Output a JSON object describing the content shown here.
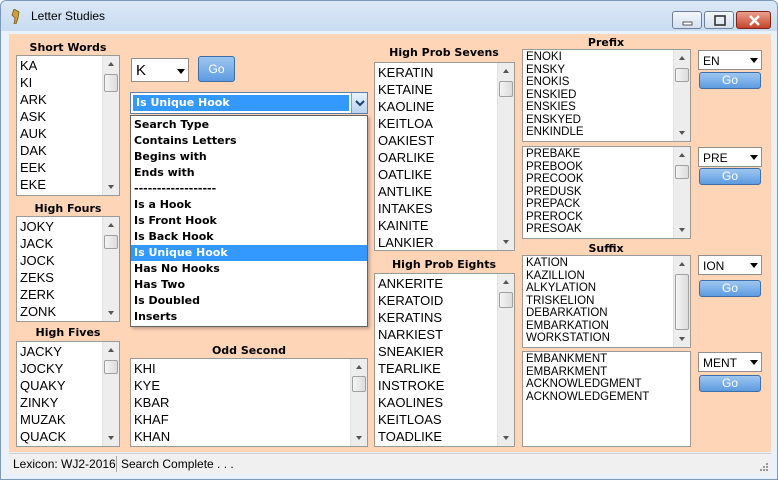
{
  "window": {
    "title": "Letter Studies"
  },
  "status": {
    "lexicon": "Lexicon: WJ2-2016",
    "message": "Search Complete . . ."
  },
  "short_words": {
    "label": "Short Words",
    "items": [
      "KA",
      "KI",
      "ARK",
      "ASK",
      "AUK",
      "DAK",
      "EEK",
      "EKE"
    ]
  },
  "high_fours": {
    "label": "High Fours",
    "items": [
      "JOKY",
      "JACK",
      "JOCK",
      "ZEKS",
      "ZERK",
      "ZONK"
    ]
  },
  "high_fives": {
    "label": "High Fives",
    "items": [
      "JACKY",
      "JOCKY",
      "QUAKY",
      "ZINKY",
      "MUZAK",
      "QUACK"
    ]
  },
  "letter_select": {
    "value": "K",
    "go": "Go"
  },
  "search_type": {
    "selected": "Is Unique Hook",
    "options": [
      "Search Type",
      "Contains Letters",
      "Begins with",
      "Ends with",
      "------------------",
      "Is a Hook",
      "Is Front Hook",
      "Is Back Hook",
      "Is Unique Hook",
      "Has No Hooks",
      "Has Two",
      "Is Doubled",
      "Inserts"
    ]
  },
  "odd_second": {
    "label": "Odd Second",
    "items": [
      "KHI",
      "KYE",
      "KBAR",
      "KHAF",
      "KHAN"
    ]
  },
  "high_prob_sevens": {
    "label": "High Prob Sevens",
    "items": [
      "KERATIN",
      "KETAINE",
      "KAOLINE",
      "KEITLOA",
      "OAKIEST",
      "OARLIKE",
      "OATLIKE",
      "ANTLIKE",
      "INTAKES",
      "KAINITE",
      "LANKIER"
    ]
  },
  "high_prob_eights": {
    "label": "High Prob Eights",
    "items": [
      "ANKERITE",
      "KERATOID",
      "KERATINS",
      "NARKIEST",
      "SNEAKIER",
      "TEARLIKE",
      "INSTROKE",
      "KAOLINES",
      "KEITLOAS",
      "TOADLIKE"
    ]
  },
  "prefix": {
    "label": "Prefix",
    "list1": [
      "ENOKI",
      "ENSKY",
      "ENOKIS",
      "ENSKIED",
      "ENSKIES",
      "ENSKYED",
      "ENKINDLE"
    ],
    "combo1": "EN",
    "list2": [
      "PREBAKE",
      "PREBOOK",
      "PRECOOK",
      "PREDUSK",
      "PREPACK",
      "PREROCK",
      "PRESOAK"
    ],
    "combo2": "PRE",
    "go": "Go"
  },
  "suffix": {
    "label": "Suffix",
    "list1": [
      "KATION",
      "KAZILLION",
      "ALKYLATION",
      "TRISKELION",
      "DEBARKATION",
      "EMBARKATION",
      "WORKSTATION"
    ],
    "combo1": "ION",
    "list2": [
      "EMBANKMENT",
      "EMBARKMENT",
      "ACKNOWLEDGMENT",
      "ACKNOWLEDGEMENT"
    ],
    "combo2": "MENT",
    "go": "Go"
  },
  "colors": {
    "client_bg": "#ffd5b8",
    "selection": "#3399ff",
    "go_button": "#5d9be0"
  }
}
